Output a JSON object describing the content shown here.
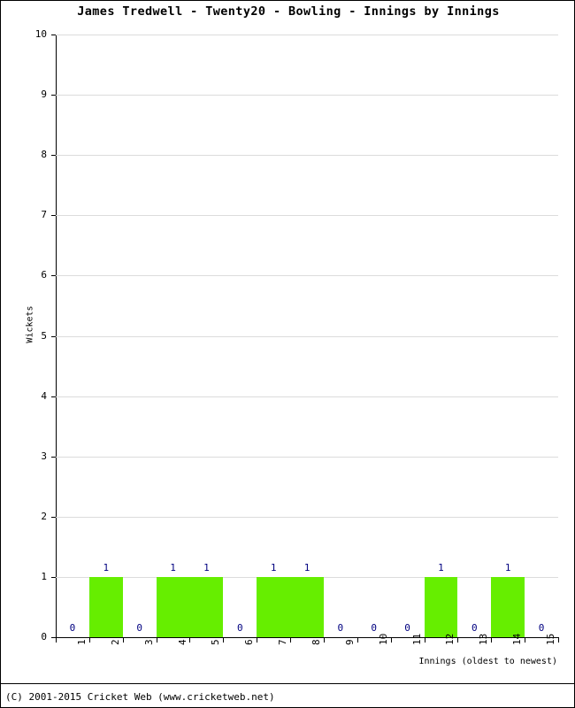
{
  "chart_data": {
    "type": "bar",
    "title": "James Tredwell - Twenty20 - Bowling - Innings by Innings",
    "xlabel": "Innings (oldest to newest)",
    "ylabel": "Wickets",
    "categories": [
      "1",
      "2",
      "3",
      "4",
      "5",
      "6",
      "7",
      "8",
      "9",
      "10",
      "11",
      "12",
      "13",
      "14",
      "15"
    ],
    "values": [
      0,
      1,
      0,
      1,
      1,
      0,
      1,
      1,
      0,
      0,
      0,
      1,
      0,
      1,
      0
    ],
    "data_labels": [
      "0",
      "1",
      "0",
      "1",
      "1",
      "0",
      "1",
      "1",
      "0",
      "0",
      "0",
      "1",
      "0",
      "1",
      "0"
    ],
    "ylim": [
      0,
      10
    ],
    "yticks": [
      0,
      1,
      2,
      3,
      4,
      5,
      6,
      7,
      8,
      9,
      10
    ],
    "ytick_labels": [
      "0",
      "1",
      "2",
      "3",
      "4",
      "5",
      "6",
      "7",
      "8",
      "9",
      "10"
    ],
    "grid": true,
    "legend": null,
    "bar_color": "#66ee00",
    "grid_color": "#dcdcdc",
    "label_color": "#000080",
    "axis_color": "#000000"
  },
  "footer": {
    "copyright": "(C) 2001-2015 Cricket Web (www.cricketweb.net)"
  }
}
